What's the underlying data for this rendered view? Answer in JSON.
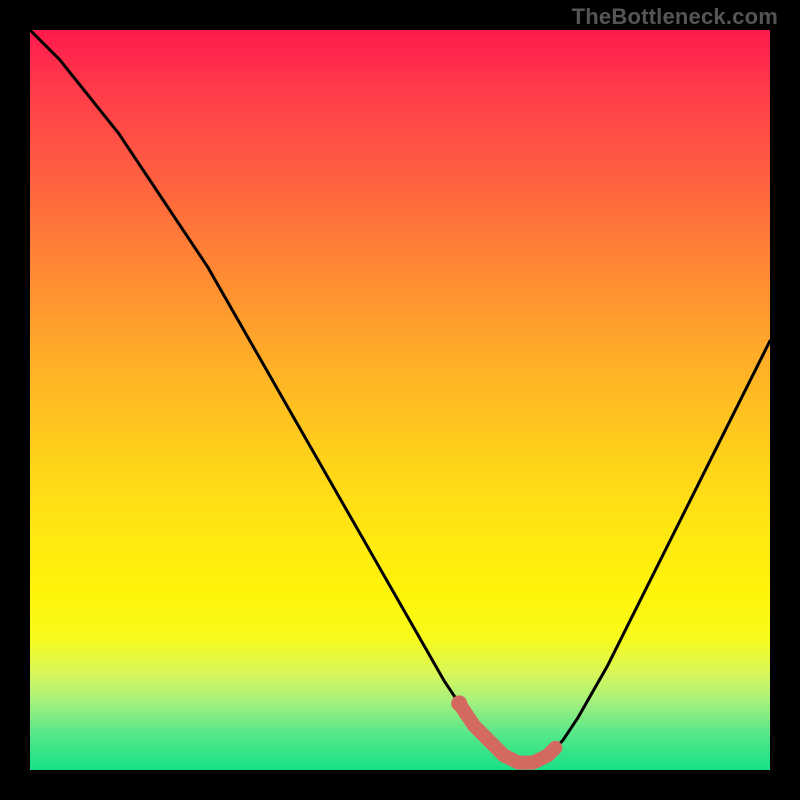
{
  "watermark": "TheBottleneck.com",
  "chart_data": {
    "type": "line",
    "title": "",
    "xlabel": "",
    "ylabel": "",
    "xlim": [
      0,
      100
    ],
    "ylim": [
      0,
      100
    ],
    "series": [
      {
        "name": "bottleneck-curve",
        "x": [
          0,
          4,
          8,
          12,
          16,
          20,
          24,
          28,
          32,
          36,
          40,
          44,
          48,
          52,
          56,
          58,
          60,
          62,
          64,
          66,
          68,
          70,
          72,
          74,
          78,
          82,
          86,
          90,
          94,
          98,
          100
        ],
        "values": [
          100,
          96,
          91,
          86,
          80,
          74,
          68,
          61,
          54,
          47,
          40,
          33,
          26,
          19,
          12,
          9,
          6,
          4,
          2,
          1,
          1,
          2,
          4,
          7,
          14,
          22,
          30,
          38,
          46,
          54,
          58
        ]
      }
    ],
    "markers": {
      "name": "highlight-segment",
      "color": "#d46a5f",
      "x": [
        58,
        60,
        62,
        64,
        66,
        68,
        70,
        71
      ],
      "values": [
        9,
        6,
        4,
        2,
        1,
        1,
        2,
        3
      ]
    },
    "gradient_stops": [
      {
        "pos": 0,
        "color": "#ff1a4d"
      },
      {
        "pos": 50,
        "color": "#ffd21a"
      },
      {
        "pos": 80,
        "color": "#fff40a"
      },
      {
        "pos": 100,
        "color": "#18e088"
      }
    ]
  }
}
